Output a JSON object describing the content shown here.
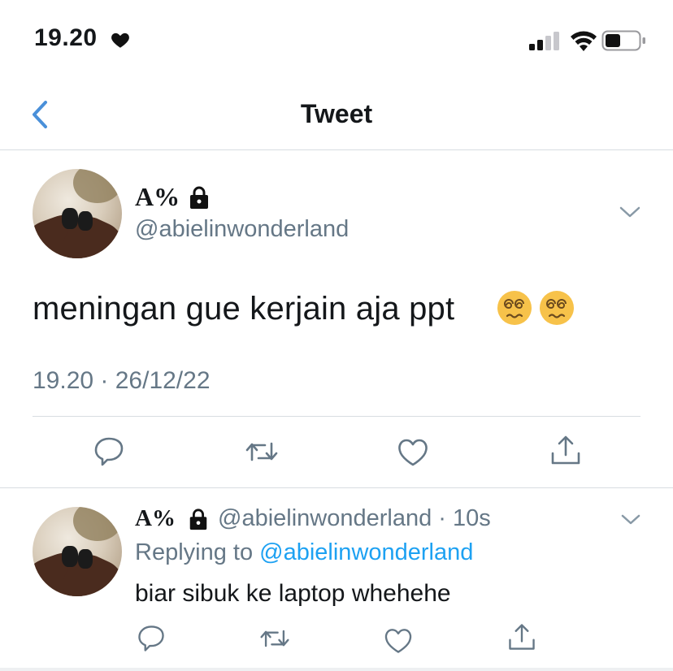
{
  "status_bar": {
    "time": "19.20",
    "heart_icon": "heart-icon",
    "signal_icon": "signal-icon",
    "wifi_icon": "wifi-icon",
    "battery_icon": "battery-icon",
    "battery_level": 0.45
  },
  "nav": {
    "title": "Tweet",
    "back_icon": "chevron-left-icon"
  },
  "tweet": {
    "name": "A%",
    "locked_icon": "lock-icon",
    "handle": "@abielinwonderland",
    "text": "meningan gue kerjain aja ppt",
    "emojis": [
      "dizzy-face-emoji",
      "dizzy-face-emoji"
    ],
    "timestamp": "19.20 · 26/12/22",
    "actions": [
      "reply-icon",
      "retweet-icon",
      "like-icon",
      "share-icon"
    ]
  },
  "reply": {
    "name": "A%",
    "handle_time": "@abielinwonderland · 10s",
    "replying_prefix": "Replying to ",
    "replying_handle": "@abielinwonderland",
    "text": "biar sibuk ke laptop whehehe"
  },
  "colors": {
    "accent": "#1da1f2",
    "back_arrow": "#4a90d9",
    "secondary_text": "#657786",
    "icon_gray": "#657786",
    "divider": "#d8dde1"
  }
}
